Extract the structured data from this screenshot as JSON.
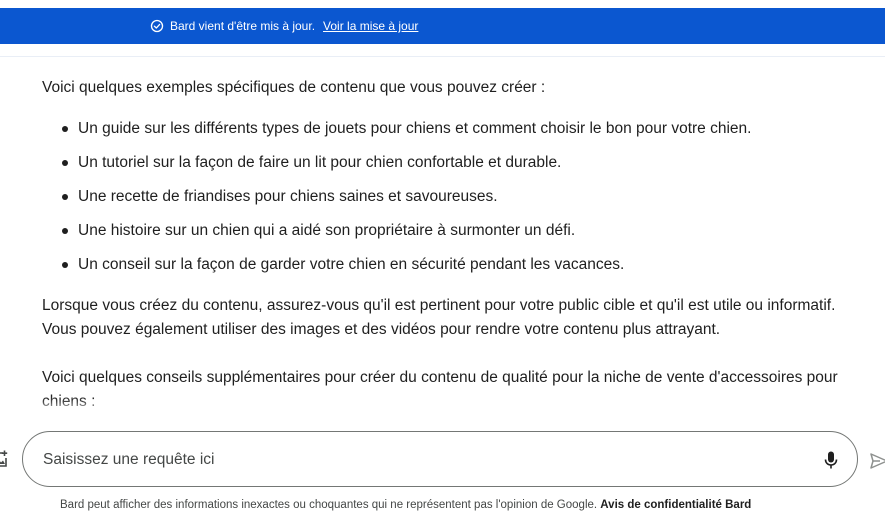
{
  "banner": {
    "message": "Bard vient d'être mis à jour.",
    "link": "Voir la mise à jour",
    "icon": "check-circle-icon",
    "background": "#0b57d0"
  },
  "content": {
    "intro": "Voici quelques exemples spécifiques de contenu que vous pouvez créer :",
    "bullets": [
      "Un guide sur les différents types de jouets pour chiens et comment choisir le bon pour votre chien.",
      "Un tutoriel sur la façon de faire un lit pour chien confortable et durable.",
      "Une recette de friandises pour chiens saines et savoureuses.",
      "Une histoire sur un chien qui a aidé son propriétaire à surmonter un défi.",
      "Un conseil sur la façon de garder votre chien en sécurité pendant les vacances."
    ],
    "paragraph_1": "Lorsque vous créez du contenu, assurez-vous qu'il est pertinent pour votre public cible et qu'il est utile ou informatif. Vous pouvez également utiliser des images et des vidéos pour rendre votre contenu plus attrayant.",
    "paragraph_2": "Voici quelques conseils supplémentaires pour créer du contenu de qualité pour la niche de vente d'accessoires pour chiens :"
  },
  "input": {
    "placeholder": "Saisissez une requête ici"
  },
  "footer": {
    "text": "Bard peut afficher des informations inexactes ou choquantes qui ne représentent pas l'opinion de Google.",
    "link": "Avis de confidentialité Bard"
  }
}
